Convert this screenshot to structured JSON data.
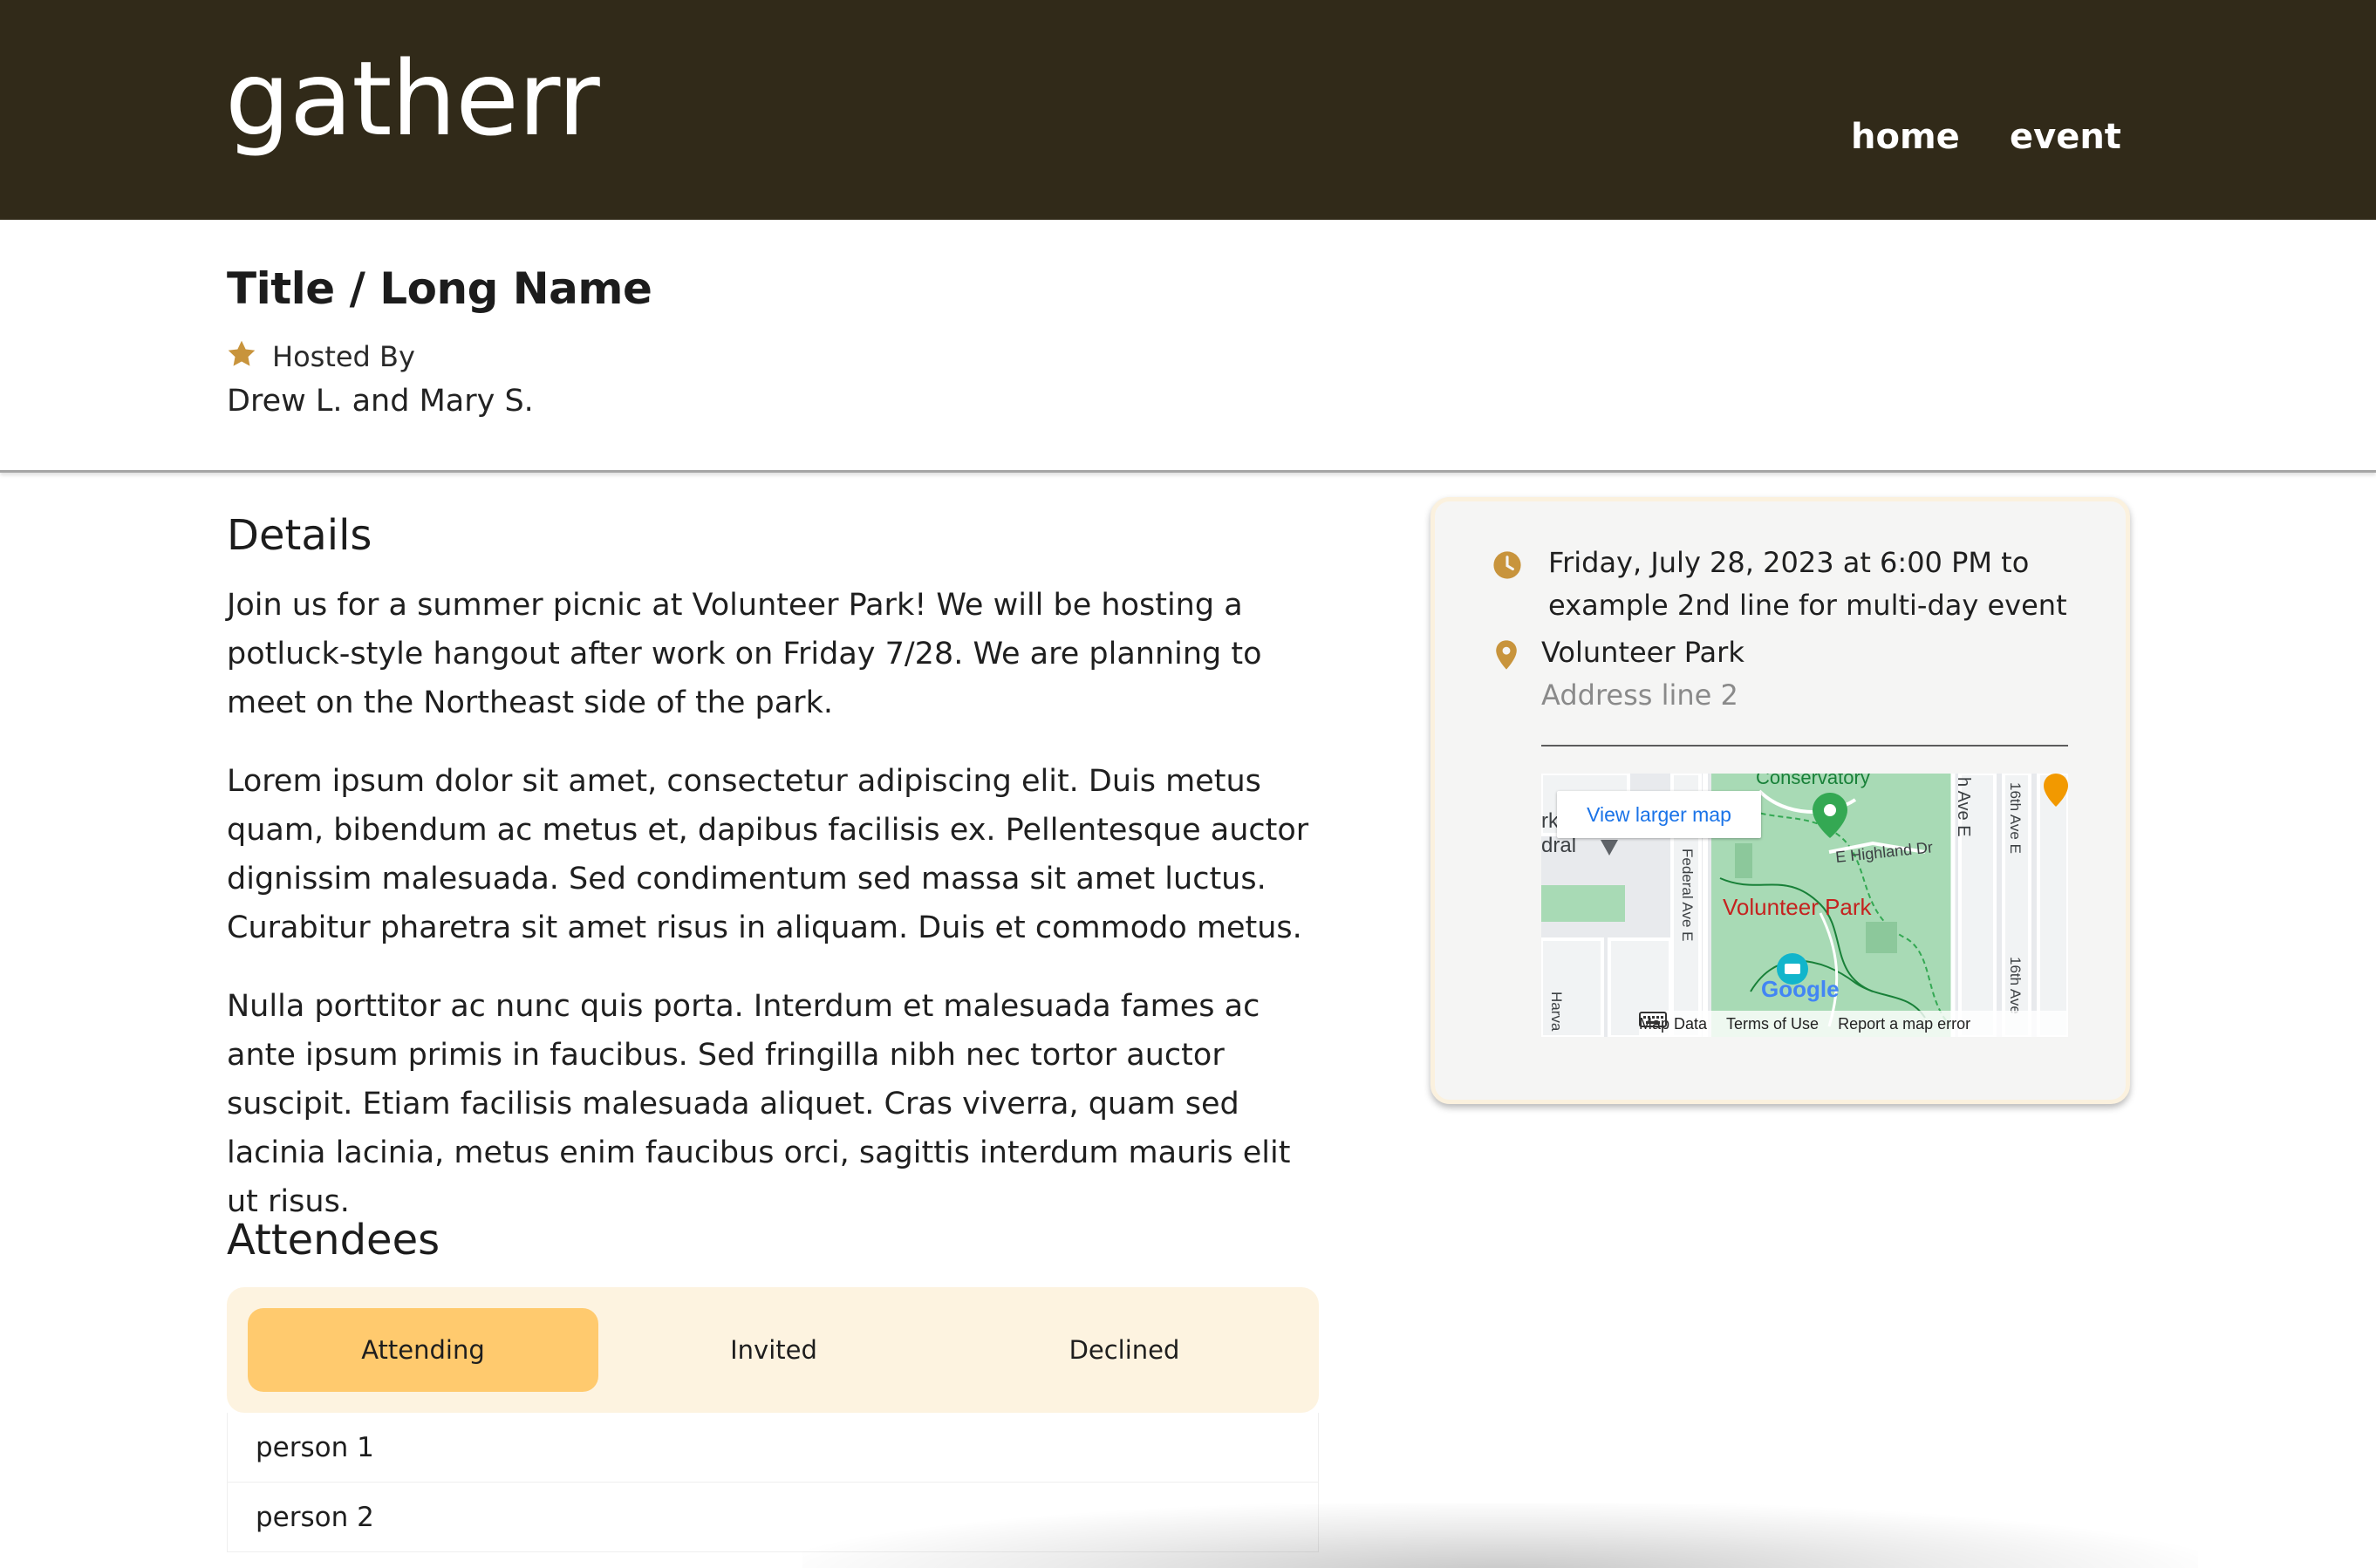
{
  "header": {
    "logo": "gatherr",
    "nav": [
      {
        "label": "home"
      },
      {
        "label": "event"
      }
    ]
  },
  "event": {
    "title": "Title / Long Name",
    "hosted_label": "Hosted By",
    "hosts": "Drew L. and Mary S."
  },
  "details": {
    "heading": "Details",
    "paragraphs": [
      "Join us for a summer picnic at Volunteer Park! We will be hosting a potluck-style hangout after work on Friday 7/28. We are planning to meet on the Northeast side of the park.",
      "Lorem ipsum dolor sit amet, consectetur adipiscing elit. Duis metus quam, bibendum ac metus et, dapibus facilisis ex. Pellentesque auctor dignissim malesuada. Sed condimentum sed massa sit amet luctus. Curabitur pharetra sit amet risus in aliquam. Duis et commodo metus.",
      "Nulla porttitor ac nunc quis porta. Interdum et malesuada fames ac ante ipsum primis in faucibus. Sed fringilla nibh nec tortor auctor suscipit. Etiam facilisis malesuada aliquet. Cras viverra, quam sed lacinia lacinia, metus enim faucibus orci, sagittis interdum mauris elit ut risus."
    ]
  },
  "attendees": {
    "heading": "Attendees",
    "tabs": [
      {
        "label": "Attending",
        "active": true
      },
      {
        "label": "Invited",
        "active": false
      },
      {
        "label": "Declined",
        "active": false
      }
    ],
    "people": [
      "person 1",
      "person 2"
    ]
  },
  "card": {
    "datetime": "Friday, July 28, 2023 at 6:00 PM to example 2nd line for multi-day event",
    "venue": "Volunteer Park",
    "address_line_2": "Address line 2",
    "map": {
      "view_larger": "View larger map",
      "park_label": "Volunteer Park",
      "top_label": "Conservatory",
      "street_highland": "E Highland Dr",
      "street_federal": "Federal Ave E",
      "street_16th": "16th Ave E",
      "street_16th_2": "16th Ave",
      "street_15th": "h Ave E",
      "street_harv": "Harva",
      "left_label_1": "rk",
      "left_label_2": "dral",
      "footer": {
        "map_data": "Map Data",
        "terms": "Terms of Use",
        "report": "Report a map error"
      },
      "google": "Google"
    }
  },
  "colors": {
    "header_bg": "#312a19",
    "accent_gold": "#c8943c",
    "tab_active": "#ffca6e",
    "tab_strip": "#fdf3e0",
    "card_border": "#fbf1de"
  },
  "icons": [
    "star-icon",
    "clock-icon",
    "map-pin-icon",
    "keyboard-icon"
  ]
}
